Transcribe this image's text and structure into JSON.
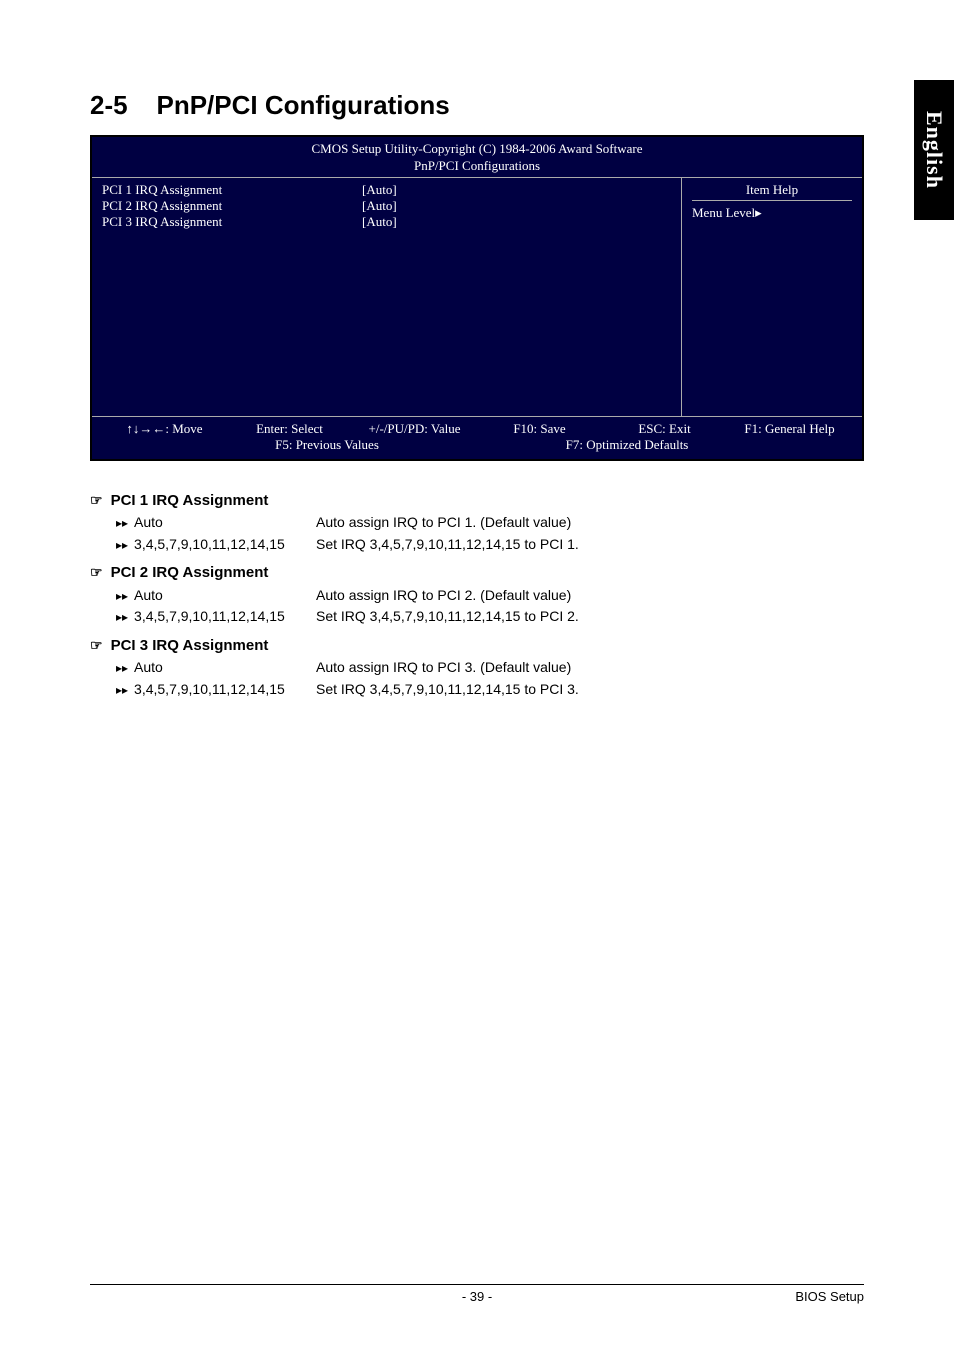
{
  "side_tab": "English",
  "section": {
    "number": "2-5",
    "title": "PnP/PCI Configurations"
  },
  "bios": {
    "header_line1": "CMOS Setup Utility-Copyright (C) 1984-2006 Award Software",
    "header_line2": "PnP/PCI Configurations",
    "rows": [
      {
        "label": "PCI 1 IRQ Assignment",
        "value": "[Auto]"
      },
      {
        "label": "PCI 2 IRQ Assignment",
        "value": "[Auto]"
      },
      {
        "label": "PCI 3 IRQ Assignment",
        "value": "[Auto]"
      }
    ],
    "help_header": "Item Help",
    "help_body": "Menu Level▸",
    "footer_line1": {
      "move": "↑↓→←: Move",
      "select": "Enter: Select",
      "value": "+/-/PU/PD: Value",
      "save": "F10: Save",
      "exit": "ESC: Exit",
      "help": "F1: General Help"
    },
    "footer_line2": {
      "prev": "F5: Previous Values",
      "opt": "F7: Optimized Defaults"
    }
  },
  "descriptions": [
    {
      "title": "PCI 1 IRQ Assignment",
      "options": [
        {
          "key": "Auto",
          "val": "Auto assign IRQ to PCI 1. (Default value)"
        },
        {
          "key": "3,4,5,7,9,10,11,12,14,15",
          "val": "Set IRQ 3,4,5,7,9,10,11,12,14,15 to PCI 1."
        }
      ]
    },
    {
      "title": "PCI 2 IRQ Assignment",
      "options": [
        {
          "key": "Auto",
          "val": "Auto assign IRQ to PCI 2. (Default value)"
        },
        {
          "key": "3,4,5,7,9,10,11,12,14,15",
          "val": "Set IRQ 3,4,5,7,9,10,11,12,14,15 to PCI 2."
        }
      ]
    },
    {
      "title": "PCI 3 IRQ Assignment",
      "options": [
        {
          "key": "Auto",
          "val": "Auto assign IRQ to PCI 3. (Default value)"
        },
        {
          "key": "3,4,5,7,9,10,11,12,14,15",
          "val": "Set IRQ 3,4,5,7,9,10,11,12,14,15 to PCI 3."
        }
      ]
    }
  ],
  "footer": {
    "page": "- 39 -",
    "section": "BIOS Setup"
  }
}
